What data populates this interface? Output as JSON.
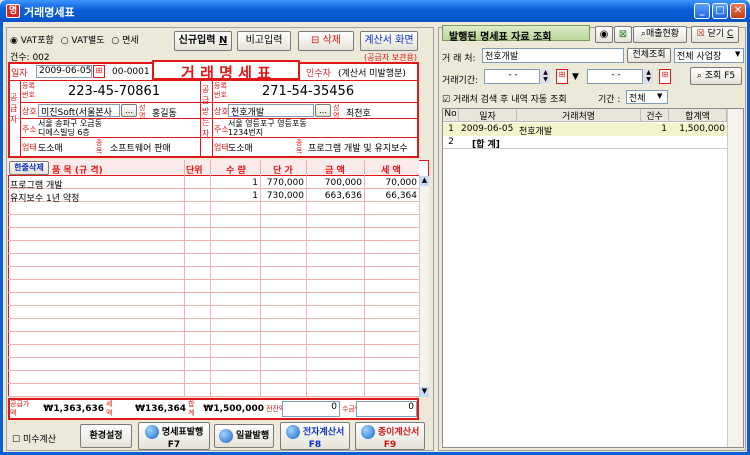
{
  "window": {
    "title": "거래명세표"
  },
  "toolbar": {
    "vat_options": [
      "VAT포함",
      "VAT별도",
      "면세"
    ],
    "count_label": "건수: 002",
    "new_input": "신규입력",
    "new_shortcut": "N",
    "note_input": "비고입력",
    "delete": "삭제",
    "invoice_screen": "계산서 화면"
  },
  "doc": {
    "title": "거 래 명 세 표",
    "subtitle": "(공급자 보관용)",
    "date_label": "일자",
    "date": "2009-06-05",
    "number": "00-0001",
    "receiver_label": "인수자",
    "status": "(계산서 미발행분)"
  },
  "supplier": {
    "side_label": "공급자",
    "reg_label": "등록번호",
    "reg_no": "223-45-70861",
    "name_label": "상호",
    "name": "미진Soft(서울본사",
    "rep_label": "성명",
    "rep": "홍길동",
    "addr_label": "주소",
    "addr1": "서울 송파구 오금동",
    "addr2": "디에스빌딩 6층",
    "type_label": "업태",
    "type": "도소매",
    "item_label": "종목",
    "item": "소프트웨어 판매"
  },
  "buyer": {
    "side_label": "공급받는자",
    "reg_label": "등록번호",
    "reg_no": "271-54-35456",
    "name_label": "상호",
    "name": "천호개발",
    "rep_label": "성명",
    "rep": "최천호",
    "addr_label": "주소",
    "addr1": "서울 영등포구 영등포동",
    "addr2": "1234번지",
    "type_label": "업태",
    "type": "도소매",
    "item_label": "종목",
    "item": "프로그램 개발 및 유지보수"
  },
  "grid": {
    "delete_row": "한줄삭제",
    "headers": [
      "품 목 (규 격)",
      "단위",
      "수 량",
      "단 가",
      "금 액",
      "세 액"
    ],
    "rows": [
      [
        "프로그램 개발",
        "",
        "1",
        "770,000",
        "700,000",
        "70,000"
      ],
      [
        "유지보수 1년 약정",
        "",
        "1",
        "730,000",
        "663,636",
        "66,364"
      ]
    ]
  },
  "totals": {
    "supply_label": "공급가액",
    "supply": "₩1,363,636",
    "tax_label": "세액",
    "tax": "₩136,364",
    "total_label": "합계",
    "total": "₩1,500,000",
    "prev_label": "전잔액",
    "prev": "0",
    "collect_label": "수금액",
    "collect": "0"
  },
  "bottom": {
    "unpaid_label": "미수계산",
    "settings": "환경설정",
    "print_stmt": "명세표발행",
    "print_stmt_key": "F7",
    "bulk": "일괄발행",
    "e_invoice": "전자계산서",
    "e_invoice_key": "F8",
    "paper_invoice": "종이계산서",
    "paper_invoice_key": "F9"
  },
  "right": {
    "title": "발행된 명세표 자료 조회",
    "sales_status": "매출현황",
    "close": "닫기",
    "close_key": "C",
    "client_label": "거 래 처:",
    "client": "천호개발",
    "all_search": "전체조회",
    "all_sites": "전체 사업장",
    "period_label": "거래기간:",
    "date_from": "-  -",
    "date_to": "-  -",
    "search": "조회",
    "search_key": "F5",
    "auto_label": "거래처 검색 후 내역 자동 조회",
    "range_label": "기간 :",
    "range": "전체",
    "columns": [
      "No",
      "일자",
      "거래처명",
      "건수",
      "합계액"
    ],
    "rows": [
      [
        "1",
        "2009-06-05",
        "천호개발",
        "1",
        "1,500,000"
      ]
    ],
    "sum_row": {
      "no": "2",
      "label": "[합 계]"
    }
  },
  "colors": {
    "accent": "#0a5fd8",
    "red": "#e01818"
  }
}
